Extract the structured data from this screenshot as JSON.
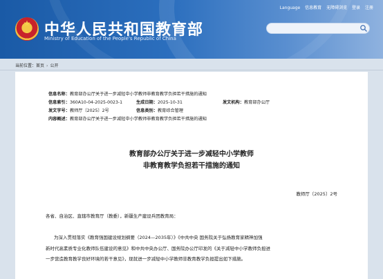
{
  "header": {
    "title": "中华人民共和国教育部",
    "subtitle": "Ministry of Education of the People's Republic of China",
    "nav": [
      "Language",
      "信息教育",
      "无障碍浏览",
      "登录",
      "注册"
    ],
    "search_placeholder": ""
  },
  "breadcrumb": {
    "prefix": "当前位置：",
    "items": [
      "首页",
      "公开"
    ]
  },
  "meta": {
    "name_label": "信息名称：",
    "name_value": "教育部办公厅关于进一步减轻中小学教师非教育教学负担若干措施的通知",
    "index_label": "信息索引：",
    "index_value": "360A10-04-2025-0023-1",
    "date_label": "生成日期：",
    "date_value": "2025-10-31",
    "agency_label": "发文机构：",
    "agency_value": "教育部办公厅",
    "docno_label": "发文字号：",
    "docno_value": "教师厅〔2025〕2号",
    "category_label": "信息类别：",
    "category_value": "教育综合管理",
    "summary_label": "内容概述：",
    "summary_value": "教育部办公厅关于进一步减轻中小学教师非教育教学负担若干措施的通知"
  },
  "document": {
    "title_line1": "教育部办公厅关于进一步减轻中小学教师",
    "title_line2": "非教育教学负担若干措施的通知",
    "doc_number": "教师厅〔2025〕2号",
    "addressee": "各省、自治区、直辖市教育厅（教委），新疆生产建设兵团教育局：",
    "body_line1": "为深入贯彻落实《教育强国建设规划纲要（2024—2035年）》《中共中央 国务院关于弘扬教育家精神加强",
    "body_line2": "新时代高素质专业化教师队伍建设的意见》和中共中央办公厅、国务院办公厅印发的《关于减轻中小学教师负担进",
    "body_line3": "一步营造教育教学良好环境的若干意见》，现就进一步减轻中小学教师非教育教学负担提出如下措施。"
  },
  "colors": {
    "header_blue": "#1a5aa6",
    "page_bg": "#d9e2ec"
  }
}
